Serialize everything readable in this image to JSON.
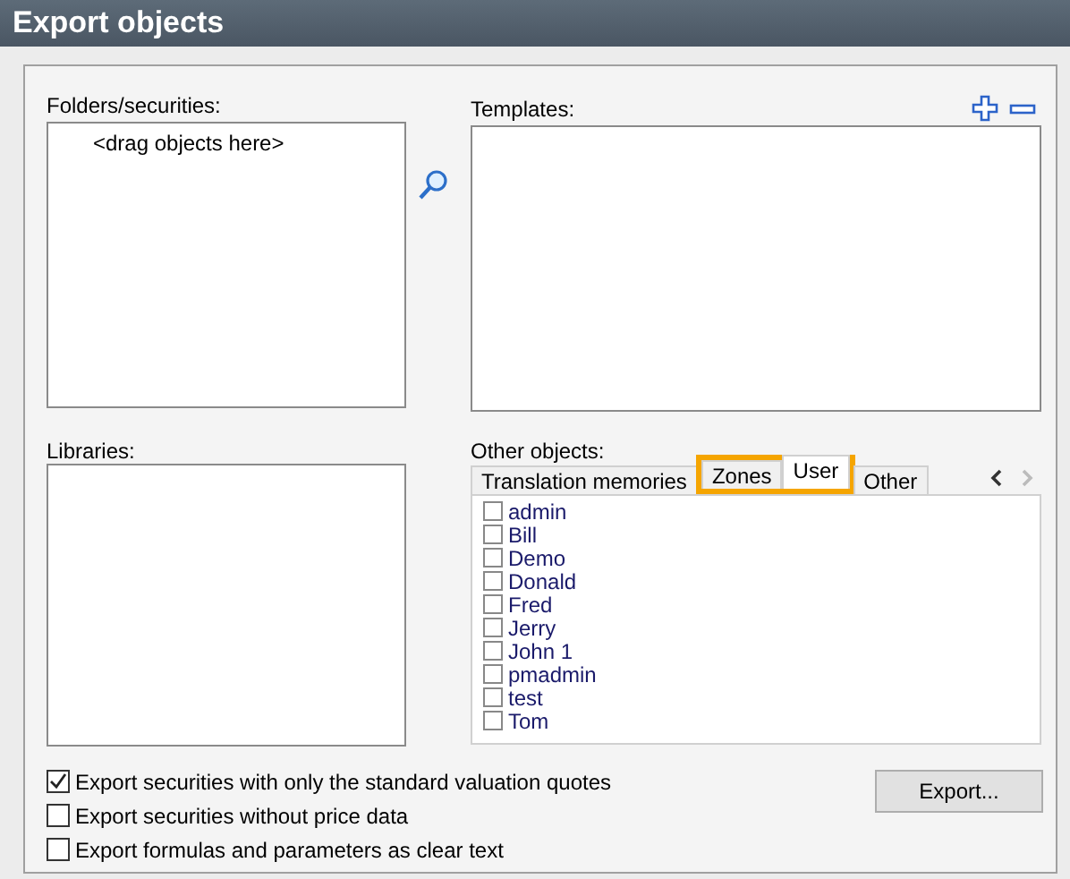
{
  "window": {
    "title": "Export objects"
  },
  "folders": {
    "label": "Folders/securities:",
    "placeholder": "<drag objects here>"
  },
  "templates": {
    "label": "Templates:"
  },
  "libraries": {
    "label": "Libraries:"
  },
  "other_objects": {
    "label": "Other objects:",
    "tabs": [
      {
        "label": "Translation memories",
        "selected": false,
        "highlighted": false
      },
      {
        "label": "Zones",
        "selected": false,
        "highlighted": true
      },
      {
        "label": "User",
        "selected": true,
        "highlighted": true
      },
      {
        "label": "Other",
        "selected": false,
        "highlighted": false
      }
    ],
    "items": [
      {
        "label": "admin",
        "checked": false
      },
      {
        "label": "Bill",
        "checked": false
      },
      {
        "label": "Demo",
        "checked": false
      },
      {
        "label": "Donald",
        "checked": false
      },
      {
        "label": "Fred",
        "checked": false
      },
      {
        "label": "Jerry",
        "checked": false
      },
      {
        "label": "John 1",
        "checked": false
      },
      {
        "label": "pmadmin",
        "checked": false
      },
      {
        "label": "test",
        "checked": false
      },
      {
        "label": "Tom",
        "checked": false
      }
    ]
  },
  "options": [
    {
      "label": "Export securities with only the standard valuation quotes",
      "checked": true
    },
    {
      "label": "Export securities without price data",
      "checked": false
    },
    {
      "label": "Export formulas and parameters as clear text",
      "checked": false
    }
  ],
  "buttons": [
    {
      "label": "Export..."
    }
  ]
}
